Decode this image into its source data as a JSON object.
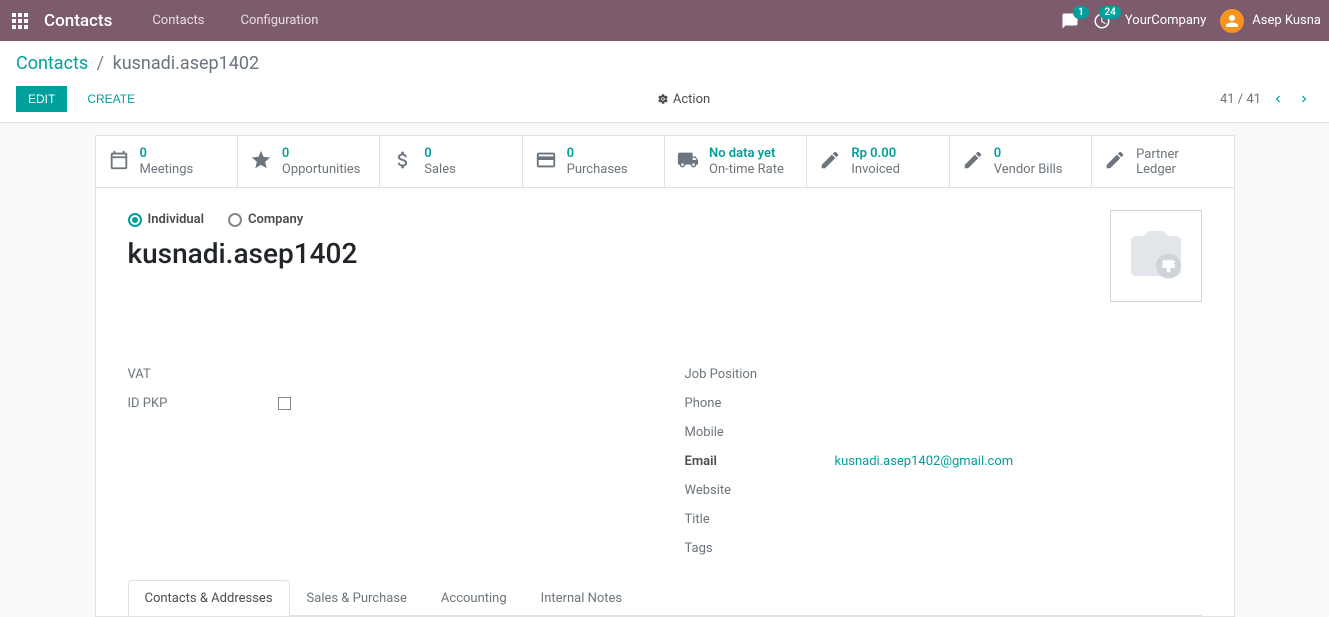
{
  "navbar": {
    "app_title": "Contacts",
    "menu": [
      "Contacts",
      "Configuration"
    ],
    "messages_badge": "1",
    "activities_badge": "24",
    "company": "YourCompany",
    "user": "Asep Kusna"
  },
  "breadcrumb": {
    "root": "Contacts",
    "current": "kusnadi.asep1402"
  },
  "buttons": {
    "edit": "Edit",
    "create": "Create",
    "action": "Action"
  },
  "pager": {
    "text": "41 / 41"
  },
  "stats": {
    "meetings": {
      "value": "0",
      "label": "Meetings"
    },
    "opportunities": {
      "value": "0",
      "label": "Opportunities"
    },
    "sales": {
      "value": "0",
      "label": "Sales"
    },
    "purchases": {
      "value": "0",
      "label": "Purchases"
    },
    "ontime": {
      "value": "No data yet",
      "label": "On-time Rate"
    },
    "invoiced": {
      "value": "Rp 0.00",
      "label": "Invoiced"
    },
    "vendor_bills": {
      "value": "0",
      "label": "Vendor Bills"
    },
    "partner_ledger": {
      "label": "Partner Ledger"
    }
  },
  "form": {
    "type_individual": "Individual",
    "type_company": "Company",
    "name": "kusnadi.asep1402",
    "left_fields": {
      "vat_label": "VAT",
      "idpkp_label": "ID PKP"
    },
    "right_fields": {
      "job_position": "Job Position",
      "phone": "Phone",
      "mobile": "Mobile",
      "email_label": "Email",
      "email_value": "kusnadi.asep1402@gmail.com",
      "website": "Website",
      "title": "Title",
      "tags": "Tags"
    }
  },
  "tabs": [
    "Contacts & Addresses",
    "Sales & Purchase",
    "Accounting",
    "Internal Notes"
  ]
}
